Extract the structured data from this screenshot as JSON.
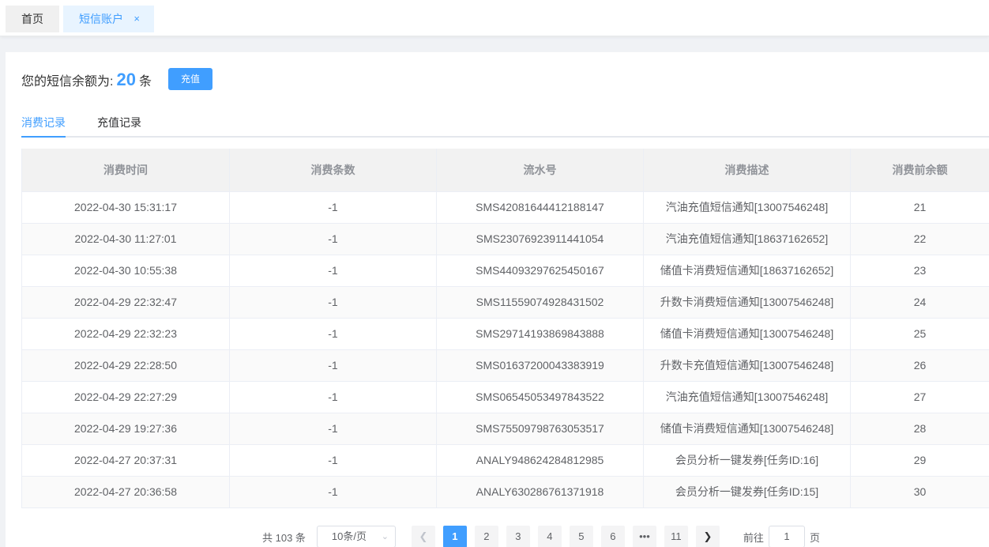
{
  "tabs": {
    "home": "首页",
    "active": "短信账户",
    "close": "×"
  },
  "balance": {
    "label": "您的短信余额为:",
    "value": "20",
    "unit": "条",
    "recharge_label": "充值"
  },
  "record_tabs": [
    "消费记录",
    "充值记录"
  ],
  "table": {
    "headers": [
      "消费时间",
      "消费条数",
      "流水号",
      "消费描述",
      "消费前余额"
    ],
    "rows": [
      [
        "2022-04-30 15:31:17",
        "-1",
        "SMS42081644412188147",
        "汽油充值短信通知[13007546248]",
        "21"
      ],
      [
        "2022-04-30 11:27:01",
        "-1",
        "SMS23076923911441054",
        "汽油充值短信通知[18637162652]",
        "22"
      ],
      [
        "2022-04-30 10:55:38",
        "-1",
        "SMS44093297625450167",
        "储值卡消费短信通知[18637162652]",
        "23"
      ],
      [
        "2022-04-29 22:32:47",
        "-1",
        "SMS11559074928431502",
        "升数卡消费短信通知[13007546248]",
        "24"
      ],
      [
        "2022-04-29 22:32:23",
        "-1",
        "SMS29714193869843888",
        "储值卡消费短信通知[13007546248]",
        "25"
      ],
      [
        "2022-04-29 22:28:50",
        "-1",
        "SMS01637200043383919",
        "升数卡充值短信通知[13007546248]",
        "26"
      ],
      [
        "2022-04-29 22:27:29",
        "-1",
        "SMS06545053497843522",
        "汽油充值短信通知[13007546248]",
        "27"
      ],
      [
        "2022-04-29 19:27:36",
        "-1",
        "SMS75509798763053517",
        "储值卡消费短信通知[13007546248]",
        "28"
      ],
      [
        "2022-04-27 20:37:31",
        "-1",
        "ANALY948624284812985",
        "会员分析一键发券[任务ID:16]",
        "29"
      ],
      [
        "2022-04-27 20:36:58",
        "-1",
        "ANALY630286761371918",
        "会员分析一键发券[任务ID:15]",
        "30"
      ]
    ]
  },
  "pagination": {
    "total": "共 103 条",
    "page_size": "10条/页",
    "pages": [
      "1",
      "2",
      "3",
      "4",
      "5",
      "6",
      "•••",
      "11"
    ],
    "current": "1",
    "prev_icon": "chevron-left-icon",
    "next_icon": "chevron-right-icon",
    "goto_label": "前往",
    "goto_value": "1",
    "goto_unit": "页"
  },
  "colors": {
    "accent": "#409eff"
  }
}
